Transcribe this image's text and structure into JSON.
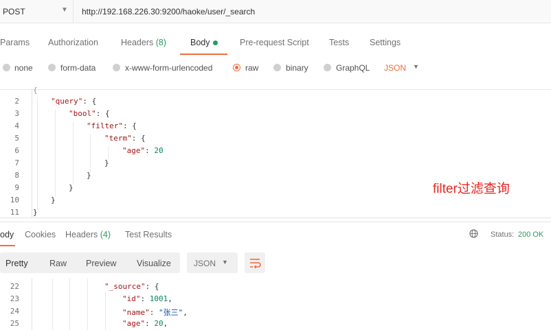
{
  "request": {
    "method": "POST",
    "url": "http://192.168.226.30:9200/haoke/user/_search"
  },
  "request_tabs": [
    {
      "label": "Params"
    },
    {
      "label": "Authorization"
    },
    {
      "label": "Headers",
      "count": "(8)"
    },
    {
      "label": "Body"
    },
    {
      "label": "Pre-request Script"
    },
    {
      "label": "Tests"
    },
    {
      "label": "Settings"
    }
  ],
  "body_types": [
    "none",
    "form-data",
    "x-www-form-urlencoded",
    "raw",
    "binary",
    "GraphQL"
  ],
  "body_selected": "raw",
  "body_format": "JSON",
  "editor": {
    "line_numbers": [
      "2",
      "3",
      "4",
      "5",
      "6",
      "7",
      "8",
      "9",
      "10",
      "11"
    ],
    "lines": [
      {
        "k": "\"query\"",
        "rest": ": {"
      },
      {
        "k": "\"bool\"",
        "rest": ": {"
      },
      {
        "k": "\"filter\"",
        "rest": ": {"
      },
      {
        "k": "\"term\"",
        "rest": ": {"
      },
      {
        "k": "\"age\"",
        "rest": ": ",
        "n": "20"
      },
      {
        "k": "",
        "rest": "}"
      },
      {
        "k": "",
        "rest": "}"
      },
      {
        "k": "",
        "rest": "}"
      },
      {
        "k": "",
        "rest": "}"
      },
      {
        "k": "",
        "rest": "}"
      }
    ]
  },
  "annotation": "filter过滤查询",
  "response_tabs": [
    {
      "label": "ody"
    },
    {
      "label": "Cookies"
    },
    {
      "label": "Headers",
      "count": "(4)"
    },
    {
      "label": "Test Results"
    }
  ],
  "status": {
    "label": "Status:",
    "value": "200 OK"
  },
  "view_modes": [
    "Pretty",
    "Raw",
    "Preview",
    "Visualize"
  ],
  "response_format": "JSON",
  "response": {
    "line_numbers": [
      "22",
      "23",
      "24",
      "25"
    ],
    "lines": [
      {
        "k": "\"_source\"",
        "rest": ": {"
      },
      {
        "k": "\"id\"",
        "rest": ": ",
        "n": "1001",
        "tail": ","
      },
      {
        "k": "\"name\"",
        "rest": ": ",
        "s": "\"张三\"",
        "tail": ","
      },
      {
        "k": "\"age\"",
        "rest": ": ",
        "n": "20",
        "tail": ","
      }
    ]
  },
  "colors": {
    "accent": "#f26b3a",
    "success": "#2b9a5a",
    "annotation": "#e8251f"
  },
  "icons": [
    "chevron-down-icon",
    "globe-icon",
    "wrap-lines-icon"
  ]
}
